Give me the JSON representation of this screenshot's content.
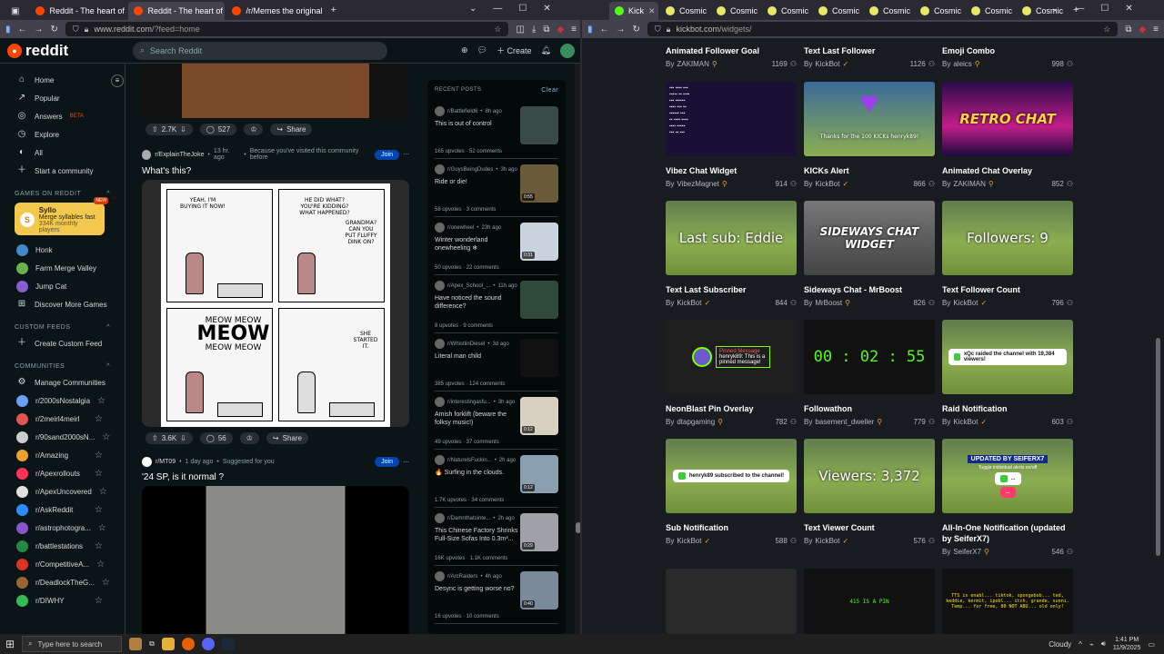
{
  "left_browser": {
    "tabs": [
      {
        "label": "Reddit - The heart of the interne",
        "active": false
      },
      {
        "label": "Reddit - The heart of the interne",
        "active": true
      },
      {
        "label": "/r/Memes the original since 200",
        "active": false
      }
    ],
    "url": "www.reddit.com",
    "url_path": "/?feed=home"
  },
  "reddit": {
    "logo": "reddit",
    "search_placeholder": "Search Reddit",
    "create_label": "Create",
    "nav": [
      "Home",
      "Popular",
      "Answers",
      "Explore",
      "All",
      "Start a community"
    ],
    "answers_badge": "BETA",
    "games_heading": "GAMES ON REDDIT",
    "syllo": {
      "title": "Syllo",
      "line1": "Merge syllables fast",
      "line2": "334K monthly players",
      "badge": "NEW"
    },
    "games": [
      "Honk",
      "Farm Merge Valley",
      "Jump Cat",
      "Discover More Games"
    ],
    "custom_feeds_heading": "CUSTOM FEEDS",
    "create_custom_feed": "Create Custom Feed",
    "communities_heading": "COMMUNITIES",
    "manage_communities": "Manage Communities",
    "communities": [
      {
        "name": "r/2000sNostalgia",
        "color": "#6aa0ff"
      },
      {
        "name": "r/2meirl4meirl",
        "color": "#e25555"
      },
      {
        "name": "r/90sand2000sN...",
        "color": "#cccccc"
      },
      {
        "name": "r/Amazing",
        "color": "#f0a030"
      },
      {
        "name": "r/Apexrollouts",
        "color": "#ff3355"
      },
      {
        "name": "r/ApexUncovered",
        "color": "#e0e0e0"
      },
      {
        "name": "r/AskReddit",
        "color": "#2b8cff"
      },
      {
        "name": "r/astrophotogra...",
        "color": "#8855cc"
      },
      {
        "name": "r/battlestations",
        "color": "#228844"
      },
      {
        "name": "r/CompetitiveA...",
        "color": "#dd3322"
      },
      {
        "name": "r/DeadlockTheG...",
        "color": "#996633"
      },
      {
        "name": "r/DIWHY",
        "color": "#33bb55"
      }
    ],
    "post0": {
      "votes": "2.7K",
      "comments": "527",
      "share": "Share"
    },
    "post1": {
      "sub": "r/ExplainTheJoke",
      "time": "13 hr. ago",
      "reason": "Because you've visited this community before",
      "join": "Join",
      "title": "What's this?",
      "votes": "3.6K",
      "comments": "56",
      "share": "Share",
      "comic": {
        "p1": "YEAH, I'M BUYING IT NOW!",
        "p2a": "HE DID WHAT? YOU'RE KIDDING? WHAT HAPPENED?",
        "p2b": "GRANDMA? CAN YOU PUT FLUFFY DINK ON?",
        "p3a": "MEOW MEOW",
        "p3b": "MEOW",
        "p3c": "MEOW MEOW",
        "p4": "SHE STARTED IT."
      }
    },
    "post2": {
      "sub": "r/MT09",
      "time": "1 day ago",
      "reason": "Suggested for you",
      "join": "Join",
      "title": "'24 SP, is it normal ?"
    },
    "recent": {
      "heading": "RECENT POSTS",
      "clear": "Clear",
      "items": [
        {
          "sub": "r/Battlefield6",
          "time": "8h ago",
          "title": "This is out of control",
          "upvotes": "165 upvotes",
          "comments": "52 comments",
          "thumb": "#3a4a48"
        },
        {
          "sub": "r/GuysBeingDudes",
          "time": "3h ago",
          "title": "Ride or die!",
          "upvotes": "58 upvotes",
          "comments": "3 comments",
          "thumb": "#6b5a3a",
          "dur": "0:55"
        },
        {
          "sub": "r/onewheel",
          "time": "23h ago",
          "title": "Winter wonderland onewheeling ❄",
          "upvotes": "50 upvotes",
          "comments": "22 comments",
          "thumb": "#c9d3dd",
          "dur": "0:31"
        },
        {
          "sub": "r/Apex_School_...",
          "time": "11h ago",
          "title": "Have noticed the sound difference?",
          "upvotes": "8 upvotes",
          "comments": "9 comments",
          "thumb": "#2f4a3a"
        },
        {
          "sub": "r/WhistlinDiesel",
          "time": "3d ago",
          "title": "Literal man child",
          "upvotes": "385 upvotes",
          "comments": "124 comments",
          "thumb": "#111111"
        },
        {
          "sub": "r/interestingasfu...",
          "time": "3h ago",
          "title": "Amish forklift (beware the folksy music!)",
          "upvotes": "49 upvotes",
          "comments": "37 comments",
          "thumb": "#d8d0c0",
          "dur": "0:12"
        },
        {
          "sub": "r/NaturelsFuckin...",
          "time": "2h ago",
          "title": "🔥 Surfing in the clouds.",
          "upvotes": "1.7K upvotes",
          "comments": "34 comments",
          "thumb": "#8aa0b0",
          "dur": "0:12"
        },
        {
          "sub": "r/Damnthatsinte...",
          "time": "2h ago",
          "title": "This Chinese Factory Shrinks Full-Size Sofas Into 0.3m³...",
          "upvotes": "16K upvotes",
          "comments": "1.1K comments",
          "thumb": "#a0a0a8",
          "dur": "0:29"
        },
        {
          "sub": "r/ArcRaiders",
          "time": "4h ago",
          "title": "Desync is getting worse no?",
          "upvotes": "16 upvotes",
          "comments": "10 comments",
          "thumb": "#7a8a9a",
          "dur": "0:40"
        }
      ]
    }
  },
  "right_browser": {
    "tabs": [
      "Kick",
      "Cosmic",
      "Cosmic",
      "Cosmic",
      "Cosmic",
      "Cosmic",
      "Cosmic",
      "Cosmic",
      "Cosmic"
    ],
    "url": "kickbot.com",
    "url_path": "/widgets/"
  },
  "kickbot": {
    "top_row": [
      {
        "title": "Animated Follower Goal",
        "author": "ZAKIMAN",
        "count": "1169"
      },
      {
        "title": "Text Last Follower",
        "author": "KickBot",
        "count": "1126"
      },
      {
        "title": "Emoji Combo",
        "author": "aleics",
        "count": "998"
      }
    ],
    "widgets": [
      {
        "title": "Vibez Chat Widget",
        "author": "VibezMagnet",
        "count": "914",
        "thumb_text": ""
      },
      {
        "title": "KICKs Alert",
        "author": "KickBot",
        "count": "866",
        "thumb_text": "Thanks for the 100 KICKs henryk89!"
      },
      {
        "title": "Animated Chat Overlay",
        "author": "ZAKIMAN",
        "count": "852",
        "thumb_text": "RETRO CHAT"
      },
      {
        "title": "Text Last Subscriber",
        "author": "KickBot",
        "count": "844",
        "thumb_text": "Last sub: Eddie"
      },
      {
        "title": "Sideways Chat - MrBoost",
        "author": "MrBoost",
        "count": "826",
        "thumb_text": "SIDEWAYS CHAT WIDGET"
      },
      {
        "title": "Text Follower Count",
        "author": "KickBot",
        "count": "796",
        "thumb_text": "Followers: 9"
      },
      {
        "title": "NeonBlast Pin Overlay",
        "author": "dtapgaming",
        "count": "782",
        "thumb_text": "henryk89: This is a pinned message!",
        "thumb_label": "Pinned Message"
      },
      {
        "title": "Followathon",
        "author": "basement_dweller",
        "count": "779",
        "thumb_text": "00 : 02 : 55"
      },
      {
        "title": "Raid Notification",
        "author": "KickBot",
        "count": "603",
        "thumb_text": "xQc raided the channel with 19,384 viewers!"
      },
      {
        "title": "Sub Notification",
        "author": "KickBot",
        "count": "588",
        "thumb_text": "henryk89 subscribed to the channel!"
      },
      {
        "title": "Text Viewer Count",
        "author": "KickBot",
        "count": "576",
        "thumb_text": "Viewers: 3,372"
      },
      {
        "title": "All-In-One Notification (updated by SeiferX7)",
        "author": "SeiferX7",
        "count": "546",
        "thumb_text": "UPDATED BY SEIFERX7",
        "thumb_sub": "Toggle individual alerts on/off"
      }
    ],
    "bottom_thumbs": [
      "",
      "415 IS A PIN",
      "TTS is enabl... tiktok, spongebob... ted, keddie, kermit, ipobl... itch, grande, sunni. Temp... for free, 80 NOT ABU... old only!"
    ]
  },
  "taskbar": {
    "search": "Type here to search",
    "weather": "Cloudy",
    "time": "1:41 PM",
    "date": "11/9/2025"
  }
}
